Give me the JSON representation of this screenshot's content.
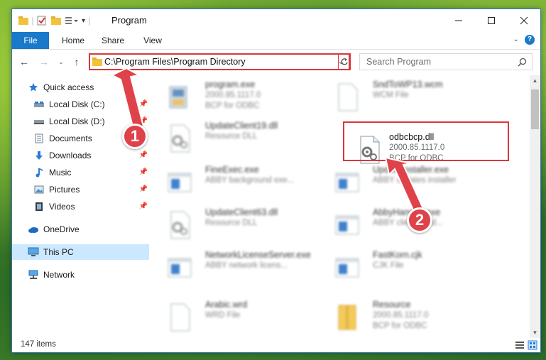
{
  "window": {
    "title": "Program"
  },
  "ribbon": {
    "tabs": [
      "File",
      "Home",
      "Share",
      "View"
    ]
  },
  "address": {
    "path": "C:\\Program Files\\Program Directory"
  },
  "search": {
    "placeholder": "Search Program"
  },
  "nav_pane": {
    "items": [
      {
        "label": "Quick access",
        "icon": "star-icon"
      },
      {
        "label": "Local Disk (C:)",
        "icon": "drive-icon"
      },
      {
        "label": "Local Disk (D:)",
        "icon": "drive-icon"
      },
      {
        "label": "Documents",
        "icon": "documents-icon"
      },
      {
        "label": "Downloads",
        "icon": "download-icon"
      },
      {
        "label": "Music",
        "icon": "music-icon"
      },
      {
        "label": "Pictures",
        "icon": "pictures-icon"
      },
      {
        "label": "Videos",
        "icon": "videos-icon"
      },
      {
        "label": "OneDrive",
        "icon": "cloud-icon"
      },
      {
        "label": "This PC",
        "icon": "computer-icon"
      },
      {
        "label": "Network",
        "icon": "network-icon"
      }
    ]
  },
  "files": [
    {
      "name": "program.exe",
      "line2": "2000.85.1117.0",
      "line3": "BCP for ODBC",
      "icon": "installer-icon"
    },
    {
      "name": "SndToWP13.wcm",
      "line2": "WCM File",
      "line3": "",
      "icon": "document-icon"
    },
    {
      "name": "UpdateClient19.dll",
      "line2": "Resource DLL",
      "line3": "",
      "icon": "dll-gear-icon"
    },
    {
      "name": "odbcbcp.dll",
      "line2": "2000.85.1117.0",
      "line3": "BCP for ODBC",
      "icon": "dll-gear-icon"
    },
    {
      "name": "FineExec.exe",
      "line2": "ABBY background exe...",
      "line3": "",
      "icon": "app-window-icon"
    },
    {
      "name": "UpdateInstaller.exe",
      "line2": "ABBY updates installer",
      "line3": "",
      "icon": "app-window-icon"
    },
    {
      "name": "UpdateClient63.dll",
      "line2": "Resource DLL",
      "line3": "",
      "icon": "dll-gear-icon"
    },
    {
      "name": "AbbyHandler.exe",
      "line2": "ABBY client hand...",
      "line3": "",
      "icon": "app-window-icon"
    },
    {
      "name": "NetworkLicenseServer.exe",
      "line2": "ABBY network licens...",
      "line3": "",
      "icon": "app-window-icon"
    },
    {
      "name": "FastKorn.cjk",
      "line2": "CJK File",
      "line3": "",
      "icon": "document-icon"
    },
    {
      "name": "Arabic.wrd",
      "line2": "WRD File",
      "line3": "",
      "icon": "document-icon"
    },
    {
      "name": "Resource",
      "line2": "2000.85.1117.0",
      "line3": "BCP for ODBC",
      "icon": "archive-icon"
    }
  ],
  "status": {
    "count": "147 items"
  },
  "callouts": {
    "one": "1",
    "two": "2",
    "color": "#e0424a"
  },
  "colors": {
    "accent": "#1979ca",
    "highlight": "#d8383b",
    "selected": "#cce8ff"
  }
}
